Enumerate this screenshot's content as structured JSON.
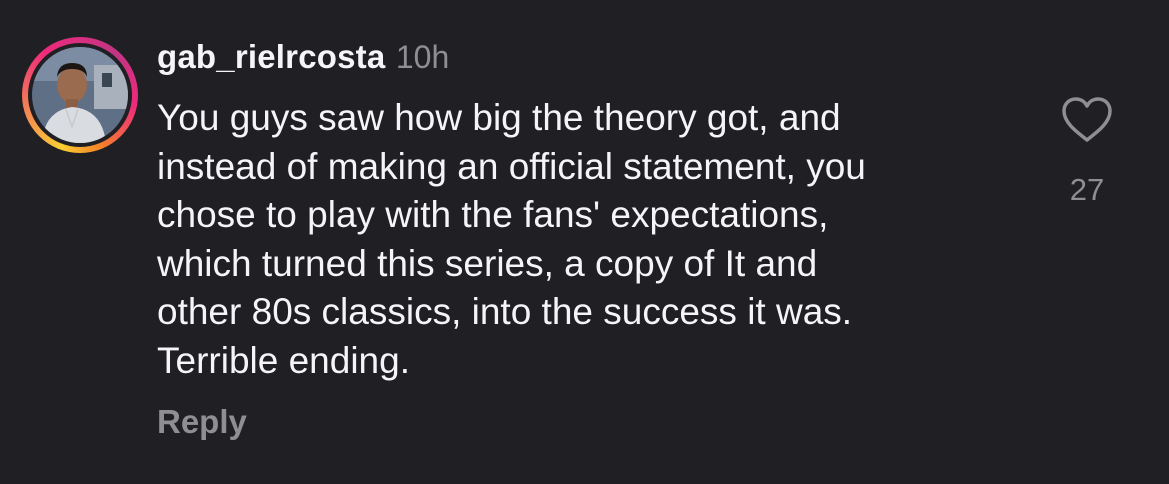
{
  "comment": {
    "username": "gab_rielrcosta",
    "time": "10h",
    "text_lines": [
      "You guys saw how big the theory got, and",
      "instead of making an official statement, you",
      "chose to play with the fans' expectations,",
      "which turned this series, a copy of It and",
      "other 80s classics, into the success it was.",
      "Terrible ending."
    ],
    "reply_label": "Reply",
    "like_count": "27",
    "like_icon": "heart-outline-icon"
  },
  "colors": {
    "background": "#1f1f24",
    "text_primary": "#f5f5f7",
    "text_secondary": "#8e8e93",
    "story_ring": [
      "#f9ce34",
      "#ee2a7b",
      "#c13584",
      "#f58529"
    ]
  }
}
